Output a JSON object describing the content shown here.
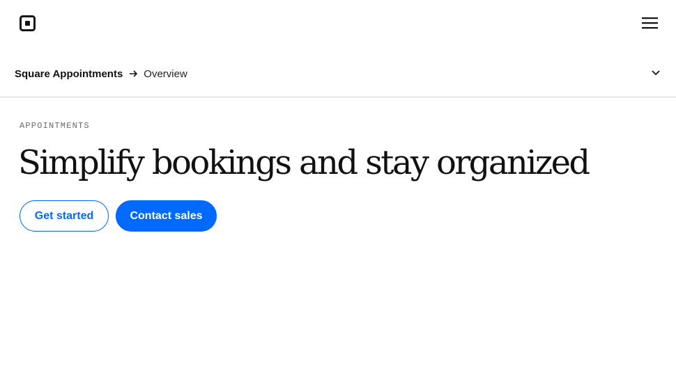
{
  "header": {
    "logo_icon": "square-logo-icon",
    "menu_icon": "hamburger-menu-icon"
  },
  "subnav": {
    "root_label": "Square Appointments",
    "separator_icon": "arrow-right-icon",
    "current_label": "Overview",
    "expand_icon": "chevron-down-icon"
  },
  "hero": {
    "eyebrow": "APPOINTMENTS",
    "headline": "Simplify bookings and stay organized",
    "primary_cta": "Get started",
    "secondary_cta": "Contact sales"
  },
  "colors": {
    "accent": "#006aff",
    "text": "#111111",
    "muted": "#6a6a6a",
    "divider": "#d6d6d6"
  }
}
